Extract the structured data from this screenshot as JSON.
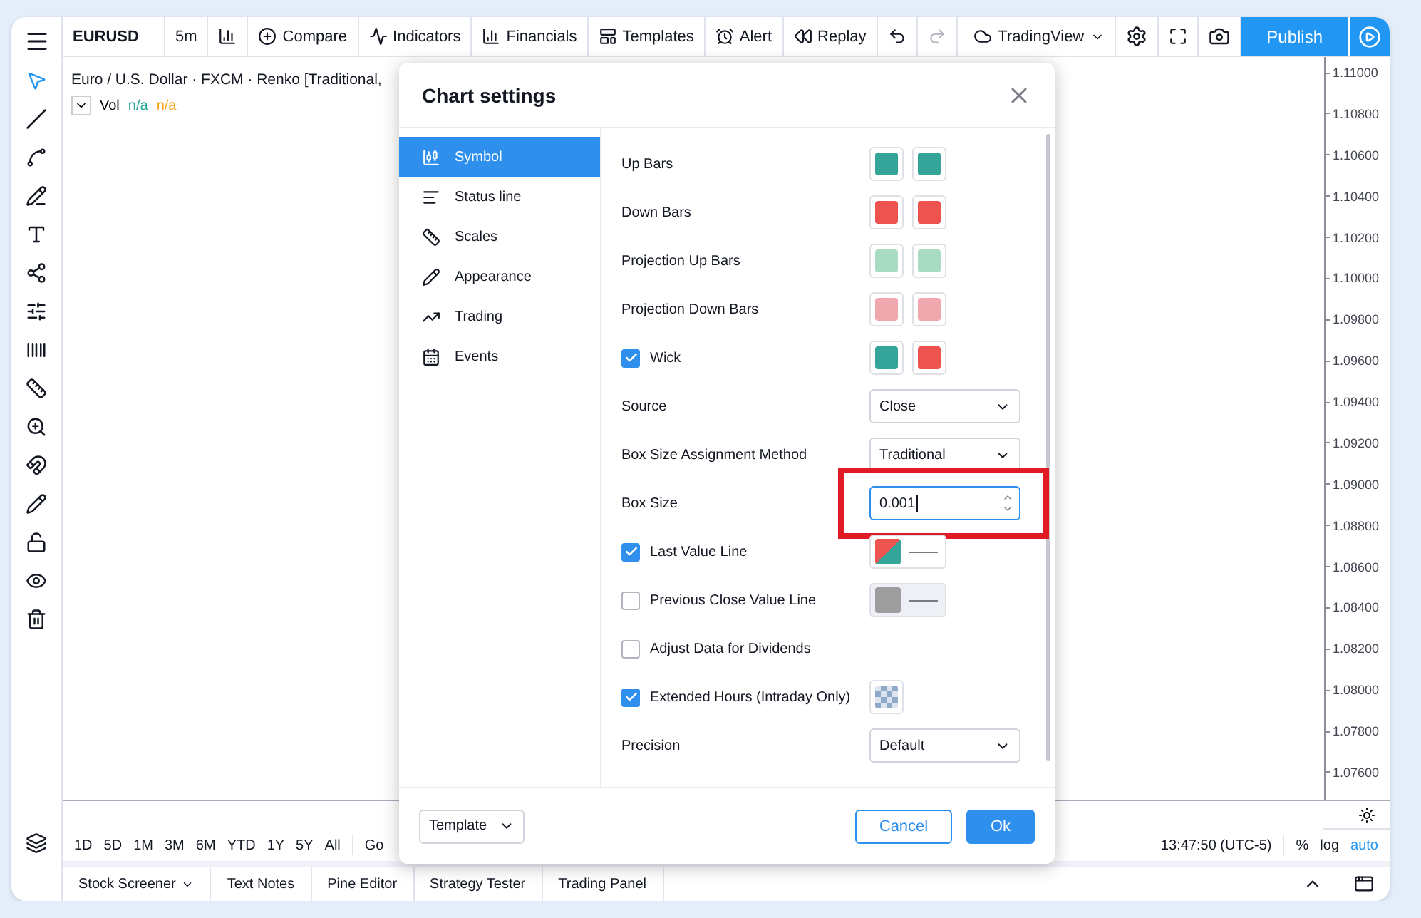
{
  "toolbar": {
    "symbol": "EURUSD",
    "interval": "5m",
    "items": [
      {
        "label": "Compare",
        "kind": "compare"
      },
      {
        "label": "Indicators",
        "kind": "indicators"
      },
      {
        "label": "Financials",
        "kind": "financials"
      },
      {
        "label": "Templates",
        "kind": "templates"
      },
      {
        "label": "Alert",
        "kind": "alert"
      },
      {
        "label": "Replay",
        "kind": "replay"
      }
    ],
    "layout": "TradingView",
    "publish": "Publish"
  },
  "legend": {
    "title": "Euro / U.S. Dollar · FXCM · Renko [Traditional,",
    "vol": "Vol",
    "values": [
      {
        "text": "n/a",
        "color": "#26a69a"
      },
      {
        "text": "n/a",
        "color": "#f7a21b"
      }
    ]
  },
  "price_axis": [
    "1.11000",
    "1.10800",
    "1.10600",
    "1.10400",
    "1.10200",
    "1.10000",
    "1.09800",
    "1.09600",
    "1.09400",
    "1.09200",
    "1.09000",
    "1.08800",
    "1.08600",
    "1.08400",
    "1.08200",
    "1.08000",
    "1.07800",
    "1.07600"
  ],
  "range_bar": {
    "ranges": [
      "1D",
      "5D",
      "1M",
      "3M",
      "6M",
      "YTD",
      "1Y",
      "5Y",
      "All"
    ],
    "goto": "Go",
    "time": "13:47:50 (UTC-5)",
    "percent": "%",
    "log": "log",
    "auto": "auto"
  },
  "bottom_tabs": [
    "Stock Screener",
    "Text Notes",
    "Pine Editor",
    "Strategy Tester",
    "Trading Panel"
  ],
  "dialog": {
    "title": "Chart settings",
    "tabs": [
      {
        "label": "Symbol",
        "kind": "symbol",
        "selected": true
      },
      {
        "label": "Status line",
        "kind": "status",
        "selected": false
      },
      {
        "label": "Scales",
        "kind": "scales",
        "selected": false
      },
      {
        "label": "Appearance",
        "kind": "appearance",
        "selected": false
      },
      {
        "label": "Trading",
        "kind": "trading",
        "selected": false
      },
      {
        "label": "Events",
        "kind": "events",
        "selected": false
      }
    ],
    "rows": [
      {
        "kind": "colors",
        "label": "Up Bars",
        "swatches": [
          {
            "color": "#35a59a"
          },
          {
            "color": "#35a59a"
          }
        ]
      },
      {
        "kind": "colors",
        "label": "Down Bars",
        "swatches": [
          {
            "color": "#ef5350"
          },
          {
            "color": "#ef5350"
          }
        ]
      },
      {
        "kind": "colors",
        "label": "Projection Up Bars",
        "swatches": [
          {
            "color": "#a9dcc3"
          },
          {
            "color": "#a9dcc3"
          }
        ]
      },
      {
        "kind": "colors",
        "label": "Projection Down Bars",
        "swatches": [
          {
            "color": "#f1a7ae"
          },
          {
            "color": "#f1a7ae"
          }
        ]
      },
      {
        "kind": "check_colors",
        "label": "Wick",
        "checked": true,
        "swatches": [
          {
            "color": "#35a59a"
          },
          {
            "color": "#ef5350"
          }
        ]
      },
      {
        "kind": "select",
        "label": "Source",
        "value": "Close"
      },
      {
        "kind": "select",
        "label": "Box Size Assignment Method",
        "value": "Traditional"
      },
      {
        "kind": "number",
        "label": "Box Size",
        "value": "0.001",
        "highlighted": true
      },
      {
        "kind": "check_line",
        "label": "Last Value Line",
        "checked": true,
        "swatches": [
          {
            "color": "#ef5350"
          },
          {
            "color": "#35a59a"
          }
        ]
      },
      {
        "kind": "check_line",
        "label": "Previous Close Value Line",
        "checked": false,
        "swatches": [
          {
            "color": "#9e9e9e"
          }
        ]
      },
      {
        "kind": "check",
        "label": "Adjust Data for Dividends",
        "checked": false
      },
      {
        "kind": "check_pattern",
        "label": "Extended Hours (Intraday Only)",
        "checked": true
      },
      {
        "kind": "select",
        "label": "Precision",
        "value": "Default"
      }
    ],
    "template": "Template",
    "cancel": "Cancel",
    "ok": "Ok"
  }
}
